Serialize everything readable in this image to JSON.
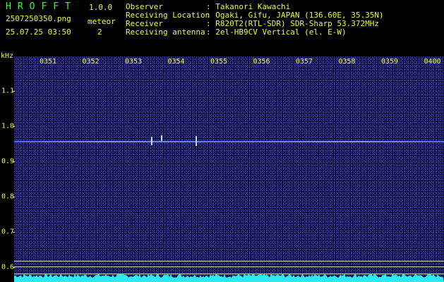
{
  "header": {
    "app_name": "HROFFT",
    "version": "1.0.0",
    "file_name": "2507250350.png",
    "datetime": "25.07.25 03:50",
    "meteor_label": "meteor",
    "meteor_count": "2",
    "info": [
      {
        "key": "Observer",
        "value": ": Takanori Kawachi"
      },
      {
        "key": "Receiving Location",
        "value": ": Ogaki, Gifu, JAPAN (136.60E, 35.35N)"
      },
      {
        "key": "Receiver",
        "value": ": R820T2(RTL-SDR) SDR-Sharp 53.372MHz"
      },
      {
        "key": "Receiving antenna",
        "value": ": 2el-HB9CV Vertical (el. E-W)"
      }
    ]
  },
  "axis": {
    "unit": "kHz",
    "x_ticks": [
      "0351",
      "0352",
      "0353",
      "0354",
      "0355",
      "0356",
      "0357",
      "0358",
      "0359",
      "0400"
    ],
    "y_ticks": [
      "1.1",
      "1.0",
      "0.9",
      "0.8",
      "0.7",
      "0.6"
    ]
  },
  "colors": {
    "header_text": "#e8ff2f",
    "app_name": "#2fff2f",
    "background": "#0a0a3c",
    "signal": "#7f8cff",
    "bottom_trace": "#2ee8f0"
  }
}
